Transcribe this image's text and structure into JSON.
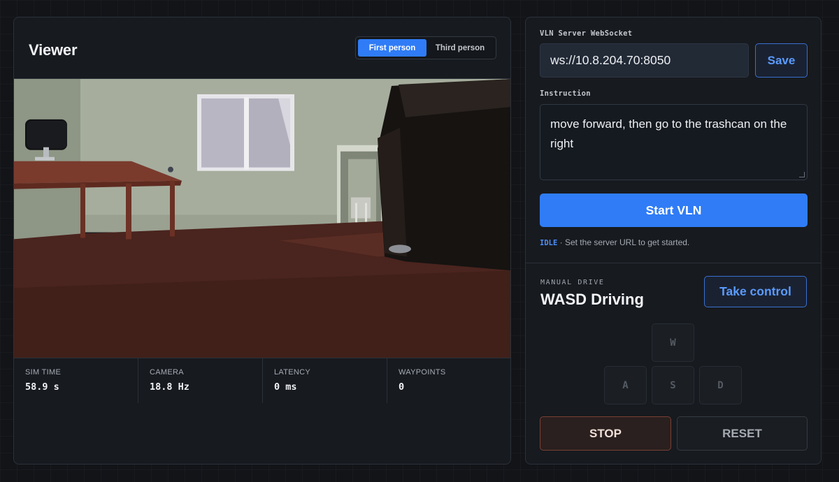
{
  "viewer": {
    "title": "Viewer",
    "view_modes": [
      "First person",
      "Third person"
    ],
    "active_view": "First person",
    "stats": [
      {
        "label": "SIM TIME",
        "value": "58.9 s"
      },
      {
        "label": "CAMERA",
        "value": "18.8 Hz"
      },
      {
        "label": "LATENCY",
        "value": "0 ms"
      },
      {
        "label": "WAYPOINTS",
        "value": "0"
      }
    ]
  },
  "server": {
    "label": "VLN Server WebSocket",
    "url": "ws://10.8.204.70:8050",
    "save_label": "Save"
  },
  "instruction": {
    "label": "Instruction",
    "text": "move forward, then go to the trashcan on the right"
  },
  "start_label": "Start VLN",
  "status": {
    "state": "IDLE",
    "message": " · Set the server URL to get started."
  },
  "manual": {
    "kicker": "MANUAL DRIVE",
    "title": "WASD Driving",
    "take_control_label": "Take control",
    "keys": {
      "w": "W",
      "a": "A",
      "s": "S",
      "d": "D"
    },
    "stop_label": "STOP",
    "reset_label": "RESET"
  },
  "colors": {
    "accent": "#2f7cf6",
    "accent_text": "#5b9bff",
    "stop_border": "#7a3f33",
    "panel": "#171a1f",
    "background": "#121418"
  }
}
